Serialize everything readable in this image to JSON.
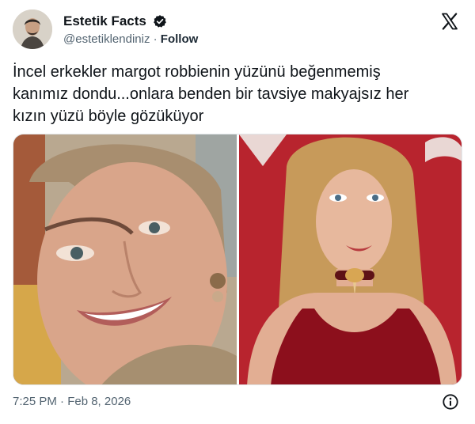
{
  "author": {
    "display_name": "Estetik Facts",
    "handle": "@estetiklendiniz",
    "separator": "·",
    "follow_label": "Follow",
    "verified": true
  },
  "post": {
    "text": "İncel erkekler margot robbienin yüzünü beğenmemiş\nkanımız dondu...onlara benden bir tavsiye makyajsız her\nkızın yüzü böyle gözüküyor",
    "images": [
      {
        "name": "makeup-free-selfie-photo"
      },
      {
        "name": "red-carpet-photo"
      }
    ]
  },
  "footer": {
    "timestamp": "7:25 PM · Feb 8, 2026"
  },
  "icons": {
    "verified": "verified-badge-icon",
    "brand": "x-logo-icon",
    "info": "info-icon"
  },
  "colors": {
    "verified": "#1d9bf0",
    "text": "#0f1419",
    "muted": "#536471",
    "red_backdrop": "#b8242e"
  }
}
